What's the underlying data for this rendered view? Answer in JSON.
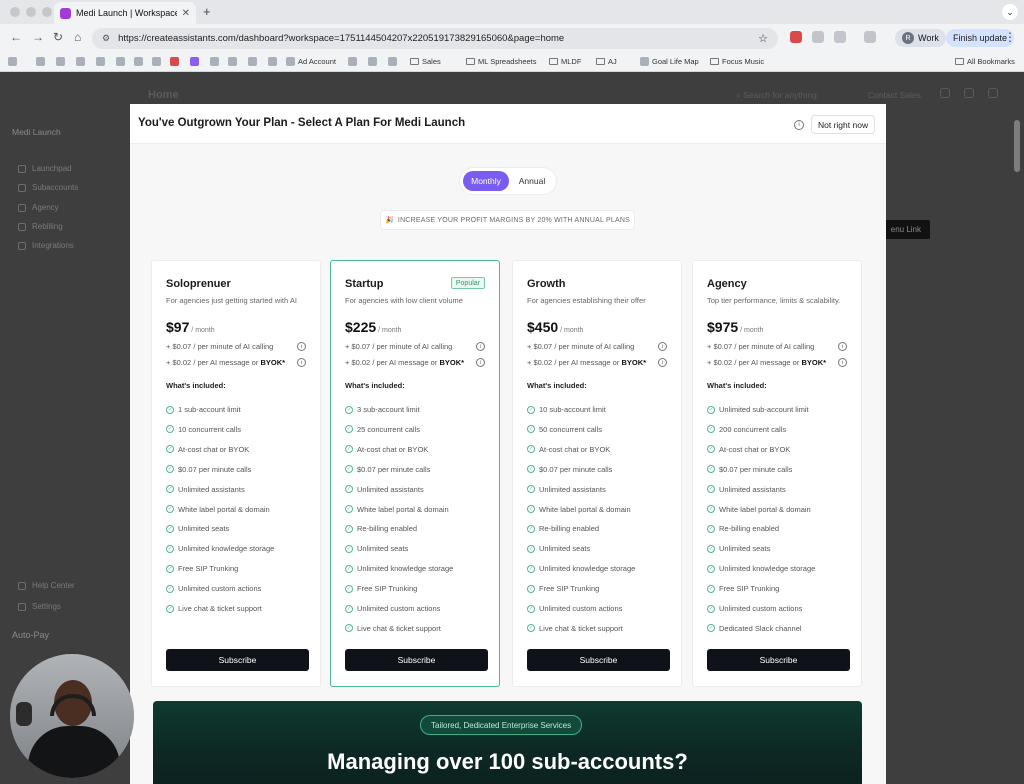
{
  "browser": {
    "tab_title": "Medi Launch | Workspace",
    "url": "https://createassistants.com/dashboard?workspace=1751144504207x220519173829165060&page=home",
    "profile_label": "Work",
    "profile_initial": "R",
    "update_label": "Finish update",
    "bookmarks": [
      "Ad Account",
      "Sales",
      "ML Spreadsheets",
      "MLDF",
      "AJ",
      "Goal Life Map",
      "Focus Music",
      "All Bookmarks"
    ]
  },
  "app": {
    "header_title": "Home",
    "search_placeholder": "Search for anything",
    "contact_sales": "Contact Sales",
    "workspace_name": "Medi Launch",
    "sidebar": [
      "Launchpad",
      "Subaccounts",
      "Agency",
      "Rebilling",
      "Integrations",
      "Help Center",
      "Settings"
    ],
    "autopay_label": "Auto-Pay",
    "ghost_button": "enu Link"
  },
  "modal": {
    "title": "You've Outgrown Your Plan - Select A Plan For Medi Launch",
    "dismiss": "Not right now",
    "toggle": [
      "Monthly",
      "Annual"
    ],
    "promo": "INCREASE YOUR PROFIT MARGINS BY 20% WITH ANNUAL PLANS",
    "plans": [
      {
        "name": "Soloprenuer",
        "badge": "",
        "desc": "For agencies just getting started with AI",
        "price": "$97",
        "per": " / month",
        "rate_calling": "+ $0.07 / per minute of AI calling",
        "rate_message": "+ $0.02 / per AI message or ",
        "byok": "BYOK*",
        "included": "What's included:",
        "features": [
          "1 sub-account limit",
          "10 concurrent calls",
          "At-cost chat or BYOK",
          "$0.07 per minute calls",
          "Unlimited assistants",
          "White label portal & domain",
          "Unlimited seats",
          "Unlimited knowledge storage",
          "Free SIP Trunking",
          "Unlimited custom actions",
          "Live chat & ticket support"
        ],
        "cta": "Subscribe"
      },
      {
        "name": "Startup",
        "badge": "Popular",
        "desc": "For agencies with low client volume",
        "price": "$225",
        "per": " / month",
        "rate_calling": "+ $0.07 / per minute of AI calling",
        "rate_message": "+ $0.02 / per AI message or ",
        "byok": "BYOK*",
        "included": "What's included:",
        "features": [
          "3 sub-account limit",
          "25 concurrent calls",
          "At-cost chat or BYOK",
          "$0.07 per minute calls",
          "Unlimited assistants",
          "White label portal & domain",
          "Re-billing enabled",
          "Unlimited seats",
          "Unlimited knowledge storage",
          "Free SIP Trunking",
          "Unlimited custom actions",
          "Live chat & ticket support"
        ],
        "cta": "Subscribe"
      },
      {
        "name": "Growth",
        "badge": "",
        "desc": "For agencies establishing their offer",
        "price": "$450",
        "per": " / month",
        "rate_calling": "+ $0.07 / per minute of AI calling",
        "rate_message": "+ $0.02 / per AI message or ",
        "byok": "BYOK*",
        "included": "What's included:",
        "features": [
          "10 sub-account limit",
          "50 concurrent calls",
          "At-cost chat or BYOK",
          "$0.07 per minute calls",
          "Unlimited assistants",
          "White label portal & domain",
          "Re-billing enabled",
          "Unlimited seats",
          "Unlimited knowledge storage",
          "Free SIP Trunking",
          "Unlimited custom actions",
          "Live chat & ticket support"
        ],
        "cta": "Subscribe"
      },
      {
        "name": "Agency",
        "badge": "",
        "desc": "Top tier performance, limits & scalability.",
        "price": "$975",
        "per": " / month",
        "rate_calling": "+ $0.07 / per minute of AI calling",
        "rate_message": "+ $0.02 / per AI message or ",
        "byok": "BYOK*",
        "included": "What's included:",
        "features": [
          "Unlimited sub-account limit",
          "200 concurrent calls",
          "At-cost chat or BYOK",
          "$0.07 per minute calls",
          "Unlimited assistants",
          "White label portal & domain",
          "Re-billing enabled",
          "Unlimited seats",
          "Unlimited knowledge storage",
          "Free SIP Trunking",
          "Unlimited custom actions",
          "Dedicated Slack channel"
        ],
        "cta": "Subscribe"
      }
    ],
    "enterprise_pill": "Tailored, Dedicated Enterprise Services",
    "enterprise_heading": "Managing over 100 sub-accounts?"
  },
  "colors": {
    "accent": "#7b5cf0",
    "popular_border": "#4bb98f",
    "cta": "#0f1219",
    "enterprise_bg": "#0f3b31"
  }
}
